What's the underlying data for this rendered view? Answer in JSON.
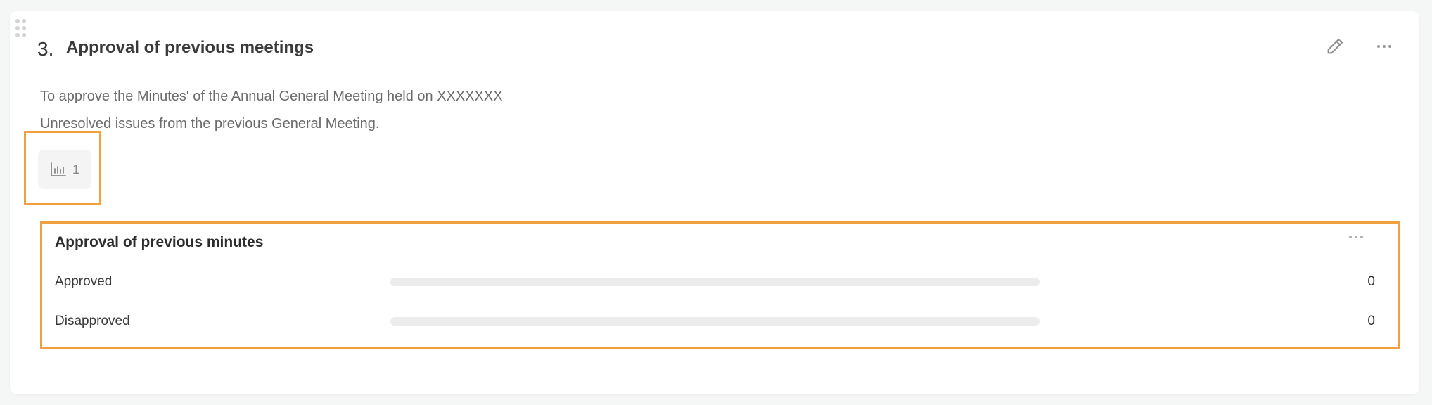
{
  "agenda_item": {
    "number": "3.",
    "title": "Approval of previous meetings",
    "description_lines": [
      "To approve the Minutes' of the Annual General Meeting held on XXXXXXX",
      "Unresolved issues from the previous General Meeting."
    ],
    "poll_count": "1"
  },
  "poll": {
    "title": "Approval of previous minutes",
    "options": [
      {
        "label": "Approved",
        "count": "0",
        "progress_percent": 0
      },
      {
        "label": "Disapproved",
        "count": "0",
        "progress_percent": 0
      }
    ]
  },
  "icons": {
    "drag": "drag-handle-icon",
    "edit": "pencil-icon",
    "more": "more-horizontal-icon",
    "poll": "bar-chart-icon"
  },
  "colors": {
    "highlight": "#f0a03f",
    "bar_track": "#ececec",
    "badge_bg": "#f4f4f4"
  }
}
